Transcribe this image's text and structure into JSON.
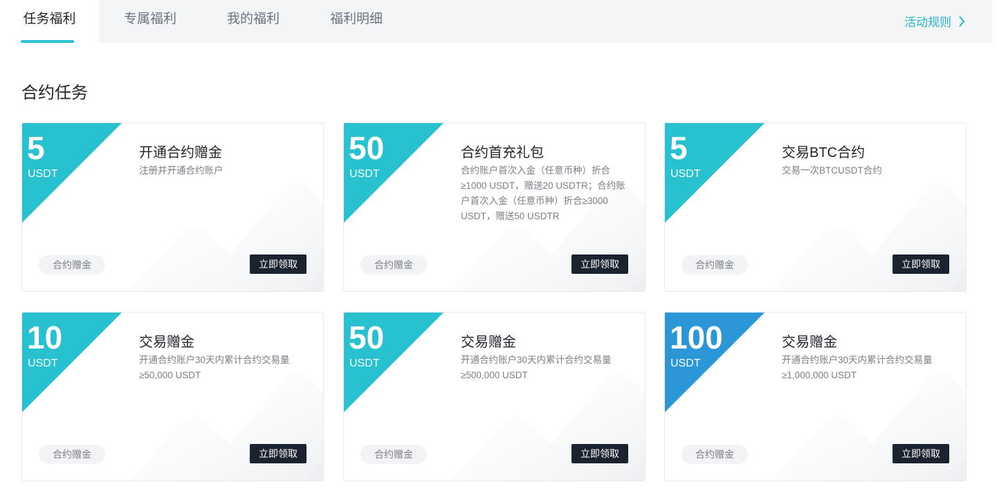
{
  "tabs": [
    {
      "label": "任务福利",
      "active": true
    },
    {
      "label": "专属福利",
      "active": false
    },
    {
      "label": "我的福利",
      "active": false
    },
    {
      "label": "福利明细",
      "active": false
    }
  ],
  "rules_link": {
    "label": "活动规则"
  },
  "section_title": "合约任务",
  "cards": [
    {
      "amount": "5",
      "unit": "USDT",
      "title": "开通合约赠金",
      "desc": "注册并开通合约账户",
      "tag": "合约赠金",
      "button": "立即领取",
      "corner_color": "#27c1d0"
    },
    {
      "amount": "50",
      "unit": "USDT",
      "title": "合约首充礼包",
      "desc": "合约账户首次入金（任意币种）折合≥1000 USDT，赠送20 USDTR；合约账户首次入金（任意币种）折合≥3000 USDT，赠送50 USDTR",
      "tag": "合约赠金",
      "button": "立即领取",
      "corner_color": "#27c1d0"
    },
    {
      "amount": "5",
      "unit": "USDT",
      "title": "交易BTC合约",
      "desc": "交易一次BTCUSDT合约",
      "tag": "合约赠金",
      "button": "立即领取",
      "corner_color": "#27c1d0"
    },
    {
      "amount": "10",
      "unit": "USDT",
      "title": "交易赠金",
      "desc": "开通合约账户30天内累计合约交易量≥50,000 USDT",
      "tag": "合约赠金",
      "button": "立即领取",
      "corner_color": "#27c1d0"
    },
    {
      "amount": "50",
      "unit": "USDT",
      "title": "交易赠金",
      "desc": "开通合约账户30天内累计合约交易量≥500,000 USDT",
      "tag": "合约赠金",
      "button": "立即领取",
      "corner_color": "#27c1d0"
    },
    {
      "amount": "100",
      "unit": "USDT",
      "title": "交易赠金",
      "desc": "开通合约账户30天内累计合约交易量≥1,000,000 USDT",
      "tag": "合约赠金",
      "button": "立即领取",
      "corner_color": "#2b97d6"
    }
  ]
}
